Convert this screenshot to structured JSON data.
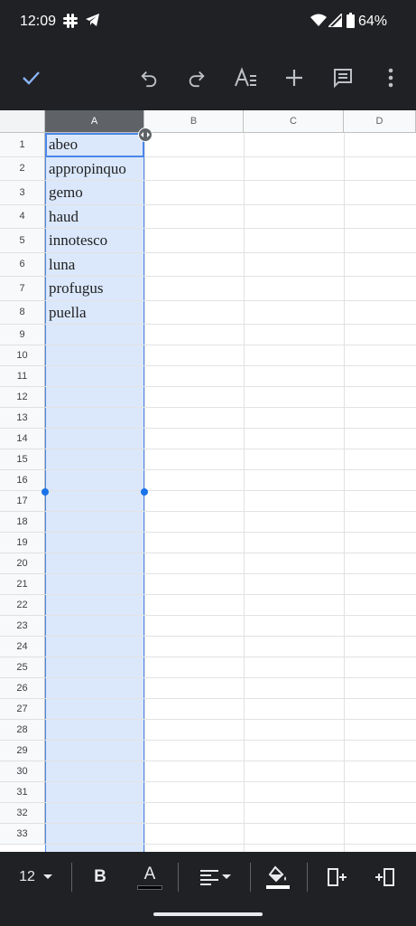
{
  "status_bar": {
    "time": "12:09",
    "battery": "64%"
  },
  "toolbar": {
    "icons": [
      "check-icon",
      "undo-icon",
      "redo-icon",
      "text-format-icon",
      "add-icon",
      "comment-icon",
      "more-vert-icon"
    ]
  },
  "sheet": {
    "columns": [
      "A",
      "B",
      "C",
      "D"
    ],
    "rows": [
      "1",
      "2",
      "3",
      "4",
      "5",
      "6",
      "7",
      "8",
      "9",
      "10",
      "11",
      "12",
      "13",
      "14",
      "15",
      "16",
      "17",
      "18",
      "19",
      "20",
      "21",
      "22",
      "23",
      "24",
      "25",
      "26",
      "27",
      "28",
      "29",
      "30",
      "31",
      "32",
      "33"
    ],
    "colA_values": [
      "abeo",
      "appropinquo",
      "gemo",
      "haud",
      "innotesco",
      "luna",
      "profugus",
      "puella"
    ]
  },
  "format_bar": {
    "font_size": "12",
    "bold_label": "B",
    "text_color_label": "A"
  },
  "colors": {
    "accent": "#4a86e8",
    "selection_fill": "#dbe8fb"
  }
}
